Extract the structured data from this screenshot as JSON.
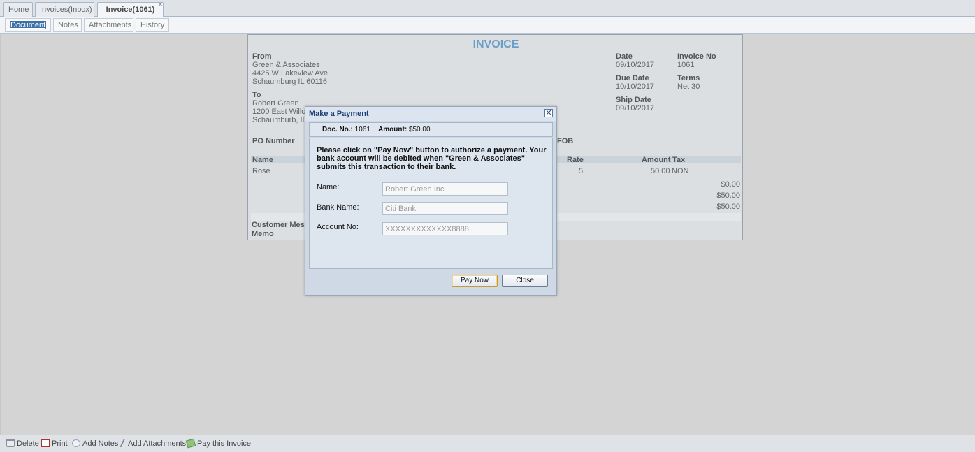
{
  "tabs": [
    {
      "label": "Home"
    },
    {
      "label": "Invoices(Inbox)"
    },
    {
      "label": "Invoice(1061)",
      "close": "✕"
    }
  ],
  "subtabs": [
    {
      "label": "Document"
    },
    {
      "label": "Notes"
    },
    {
      "label": "Attachments"
    },
    {
      "label": "History"
    }
  ],
  "invoice": {
    "title": "INVOICE",
    "from_label": "From",
    "from_lines": [
      "Green & Associates",
      "4425 W Lakeview Ave",
      "Schaumburg IL  60116"
    ],
    "to_label": "To",
    "to_lines": [
      "Robert Green",
      "1200 East Willo",
      "Schaumburb, IL"
    ],
    "date_label": "Date",
    "date": "09/10/2017",
    "invoice_no_label": "Invoice No",
    "invoice_no": "1061",
    "due_date_label": "Due Date",
    "due_date": "10/10/2017",
    "terms_label": "Terms",
    "terms": "Net 30",
    "ship_date_label": "Ship Date",
    "ship_date": "09/10/2017",
    "po_label": "PO Number",
    "fob_label": "FOB",
    "col_name": "Name",
    "col_rate": "Rate",
    "col_amount": "Amount",
    "col_tax": "Tax",
    "row_name": "Rose",
    "row_rate": "5",
    "row_amount": "50.00",
    "row_tax": "NON",
    "subtotal_1": "$0.00",
    "subtotal_2": "$50.00",
    "total": "$50.00",
    "customer_message_label": "Customer Mess",
    "memo_label": "Memo"
  },
  "modal": {
    "title": "Make a Payment",
    "close_icon": "✕",
    "doc_no_label": "Doc. No.:",
    "doc_no": "1061",
    "amount_label": "Amount:",
    "amount": "$50.00",
    "message": "Please click on \"Pay Now\" button to authorize a payment. Your bank account will be debited when \"Green & Associates\" submits this transaction to their bank.",
    "name_label": "Name:",
    "name_value": "Robert Green Inc.",
    "bank_label": "Bank Name:",
    "bank_value": "Citi Bank",
    "account_label": "Account No:",
    "account_value": "XXXXXXXXXXXXX8888",
    "pay_now": "Pay Now",
    "close": "Close"
  },
  "toolbar": {
    "delete": "Delete",
    "print": "Print",
    "add_notes": "Add Notes",
    "add_attachments": "Add Attachments",
    "pay_invoice": "Pay this Invoice"
  }
}
